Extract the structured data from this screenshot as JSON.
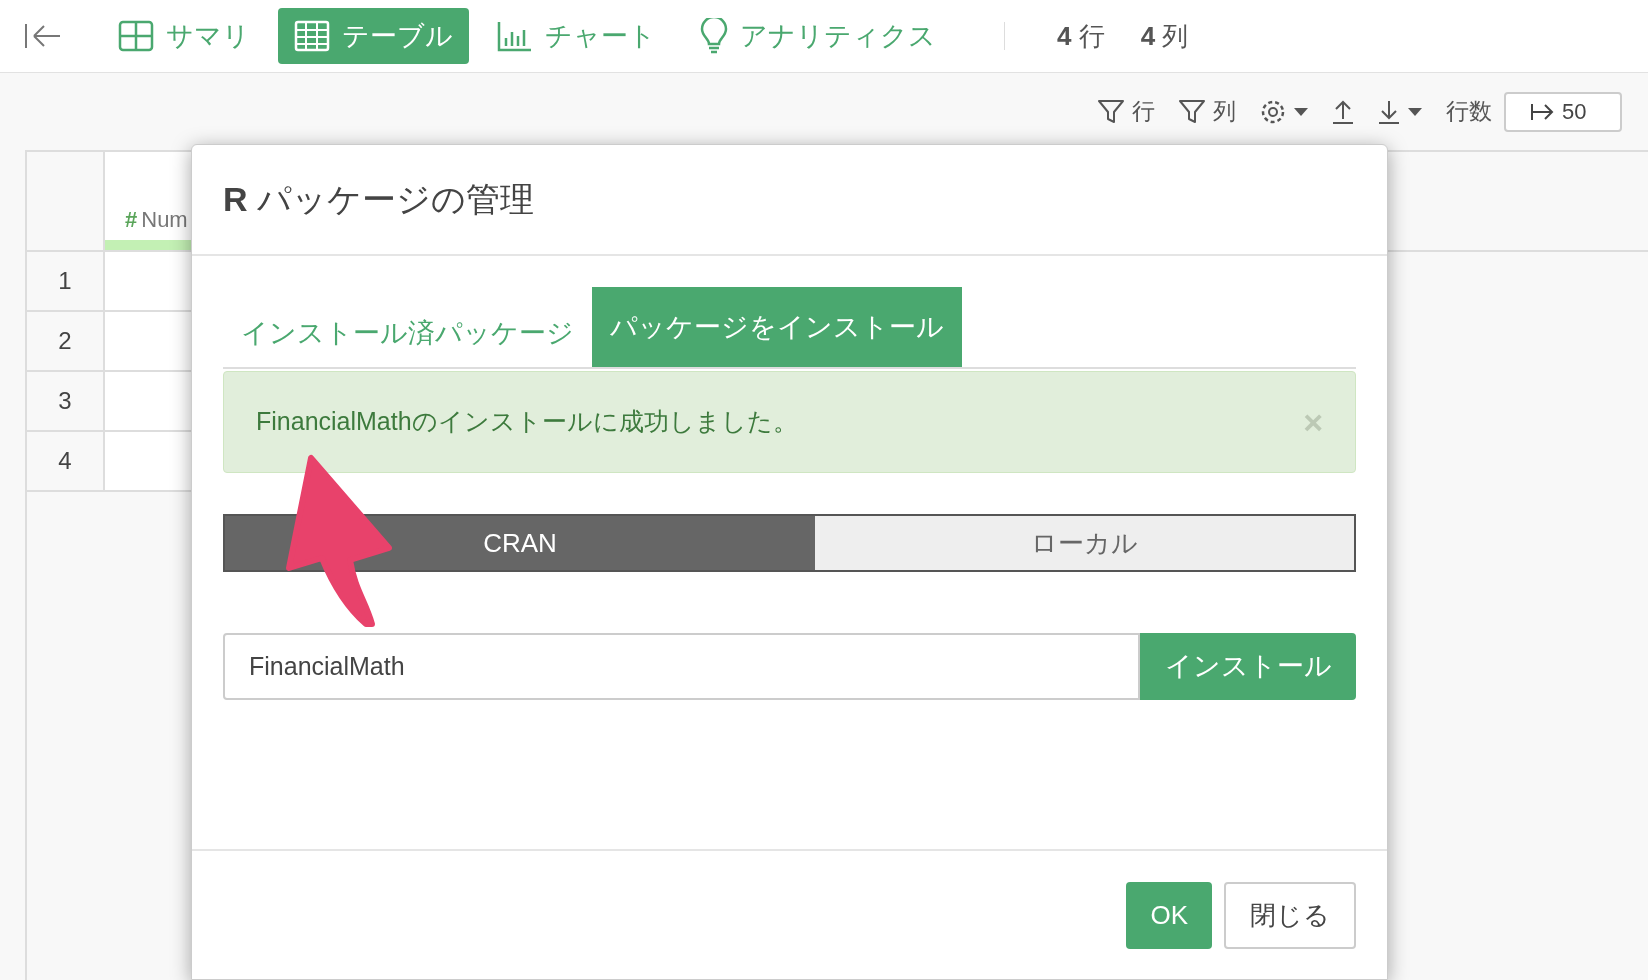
{
  "nav": {
    "tabs": [
      {
        "label": "サマリ",
        "selected": false
      },
      {
        "label": "テーブル",
        "selected": true
      },
      {
        "label": "チャート",
        "selected": false
      },
      {
        "label": "アナリティクス",
        "selected": false
      }
    ],
    "counts": [
      "**4** 行",
      "**4** 列"
    ]
  },
  "toolbar": {
    "items": [
      {
        "kind": "filter",
        "label": "行"
      },
      {
        "kind": "filter",
        "label": "列"
      },
      {
        "kind": "settings"
      },
      {
        "kind": "upload"
      },
      {
        "kind": "download"
      }
    ],
    "rows_label": "行数",
    "rows_value": "50"
  },
  "table": {
    "column_type": "#",
    "column_type_name": "Num",
    "rows": [
      "1",
      "2",
      "3",
      "4"
    ]
  },
  "dialog": {
    "title": "**R** パッケージの管理",
    "tabs": [
      {
        "label": "インストール済パッケージ",
        "selected": false
      },
      {
        "label": "パッケージをインストール",
        "selected": true
      }
    ],
    "alert": {
      "message": "FinancialMathのインストールに成功しました。",
      "close": "×"
    },
    "sources": [
      {
        "label": "CRAN",
        "selected": true
      },
      {
        "label": "ローカル",
        "selected": false
      }
    ],
    "package_value": "FinancialMath",
    "install_button": "インストール",
    "buttons": [
      {
        "label": "OK",
        "kind": "primary"
      },
      {
        "label": "閉じる",
        "kind": "default"
      }
    ]
  }
}
